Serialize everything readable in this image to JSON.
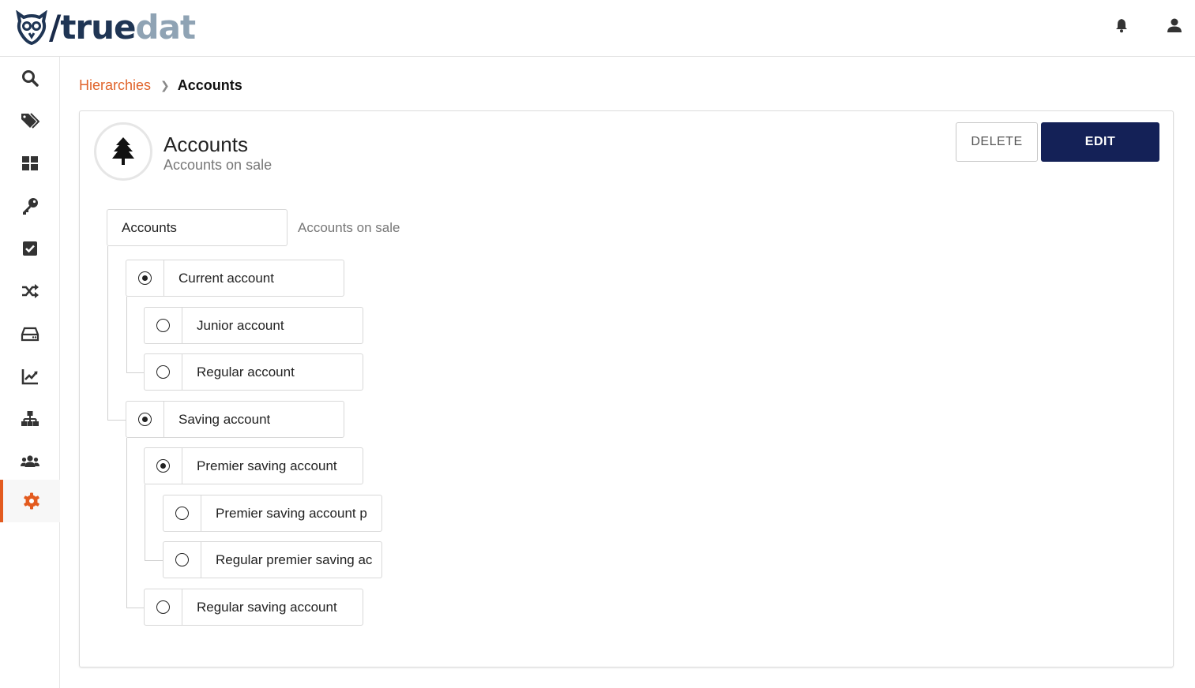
{
  "app": {
    "logo_slash": "/",
    "logo_true": "true",
    "logo_dat": "dat",
    "accent_color": "#e35b1f",
    "primary_color": "#142157"
  },
  "topbar": {
    "icons": [
      "bell-icon",
      "user-icon"
    ]
  },
  "sidebar": {
    "items": [
      {
        "name": "search",
        "icon": "search-icon"
      },
      {
        "name": "tags",
        "icon": "tags-icon"
      },
      {
        "name": "dashboard",
        "icon": "grid-icon"
      },
      {
        "name": "keys",
        "icon": "key-icon"
      },
      {
        "name": "rules",
        "icon": "checkbox-icon"
      },
      {
        "name": "lineage",
        "icon": "shuffle-icon"
      },
      {
        "name": "storage",
        "icon": "hard-drive-icon"
      },
      {
        "name": "metrics",
        "icon": "chart-line-icon"
      },
      {
        "name": "structures",
        "icon": "sitemap-icon"
      },
      {
        "name": "users",
        "icon": "users-icon"
      },
      {
        "name": "settings",
        "icon": "gear-icon",
        "active": true
      }
    ]
  },
  "breadcrumb": {
    "parent": "Hierarchies",
    "current": "Accounts"
  },
  "hierarchy": {
    "title": "Accounts",
    "description": "Accounts on sale",
    "icon": "tree-icon",
    "delete_label": "DELETE",
    "edit_label": "EDIT"
  },
  "tree": {
    "root": {
      "label": "Accounts",
      "description": "Accounts on sale"
    },
    "nodes": [
      {
        "label": "Current account",
        "checked": true
      },
      {
        "label": "Junior account",
        "checked": false
      },
      {
        "label": "Regular account",
        "checked": false
      },
      {
        "label": "Saving account",
        "checked": true
      },
      {
        "label": "Premier saving account",
        "checked": true
      },
      {
        "label": "Premier saving account p",
        "checked": false
      },
      {
        "label": "Regular premier saving ac",
        "checked": false
      },
      {
        "label": "Regular saving account",
        "checked": false
      }
    ]
  }
}
